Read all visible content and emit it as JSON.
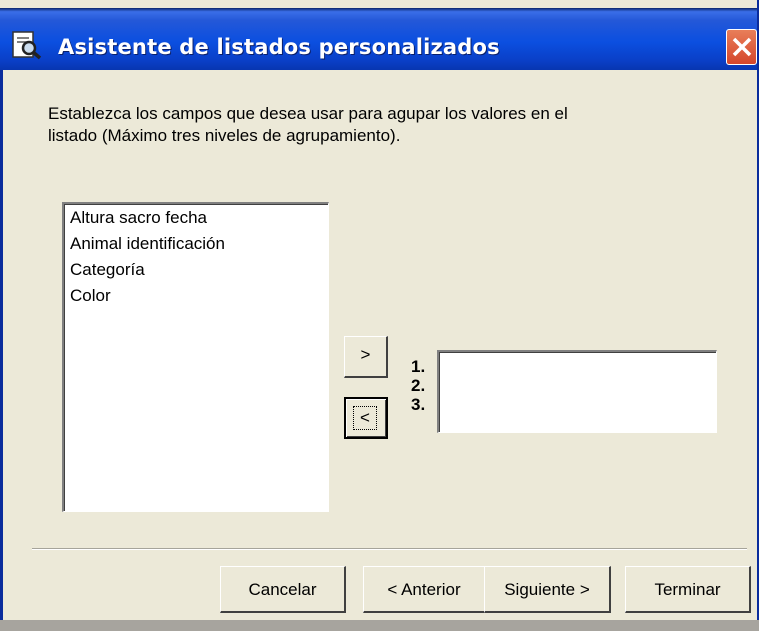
{
  "window": {
    "title": "Asistente de listados personalizados",
    "title_icon": "preview-icon",
    "close_icon": "close-icon"
  },
  "instruction": {
    "line1": "Establezca los campos que desea usar para agupar los valores en el",
    "line2": "listado (Máximo tres niveles de agrupamiento)."
  },
  "available_fields": [
    "Altura sacro fecha",
    "Animal identificación",
    "Categoría",
    "Color"
  ],
  "transfer": {
    "add_label": ">",
    "remove_label": "<"
  },
  "levels": [
    "1.",
    "2.",
    "3."
  ],
  "buttons": {
    "cancel": "Cancelar",
    "previous": "< Anterior",
    "next": "Siguiente >",
    "finish": "Terminar"
  },
  "colors": {
    "titlebar": "#0b4fe0",
    "close": "#d5462b",
    "dialog_bg": "#ece9d8"
  }
}
